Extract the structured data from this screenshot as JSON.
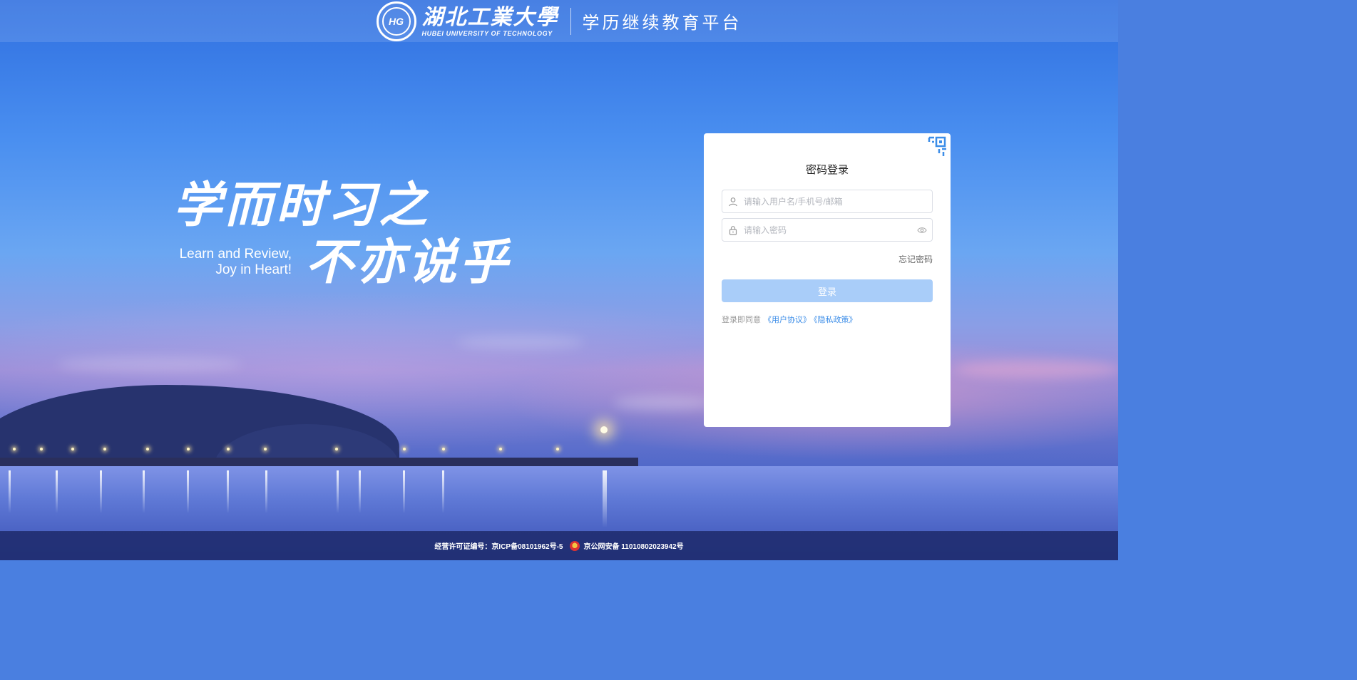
{
  "header": {
    "university_cn": "湖北工業大學",
    "university_en": "HUBEI UNIVERSITY OF TECHNOLOGY",
    "platform_title": "学历继续教育平台"
  },
  "slogan": {
    "line1_cn": "学而时习之",
    "line2_cn": "不亦说乎",
    "en_line1": "Learn and Review,",
    "en_line2": "Joy in Heart!"
  },
  "login": {
    "title": "密码登录",
    "username_placeholder": "请输入用户名/手机号/邮箱",
    "password_placeholder": "请输入密码",
    "forgot_password": "忘记密码",
    "login_button": "登录",
    "agree_text": "登录即同意",
    "user_agreement": "《用户协议》",
    "privacy_policy": "《隐私政策》"
  },
  "footer": {
    "license": "经营许可证编号：京ICP备08101962号-5",
    "police_record": "京公网安备 11010802023942号"
  },
  "colors": {
    "accent": "#3d8ee8",
    "button_disabled": "#a9cdf9",
    "footer_bg": "#1a2460"
  },
  "icons": {
    "seal": "university-seal-icon",
    "qr": "qr-code-icon",
    "user": "user-icon",
    "lock": "lock-icon",
    "eye": "eye-icon",
    "badge": "police-badge-icon"
  }
}
